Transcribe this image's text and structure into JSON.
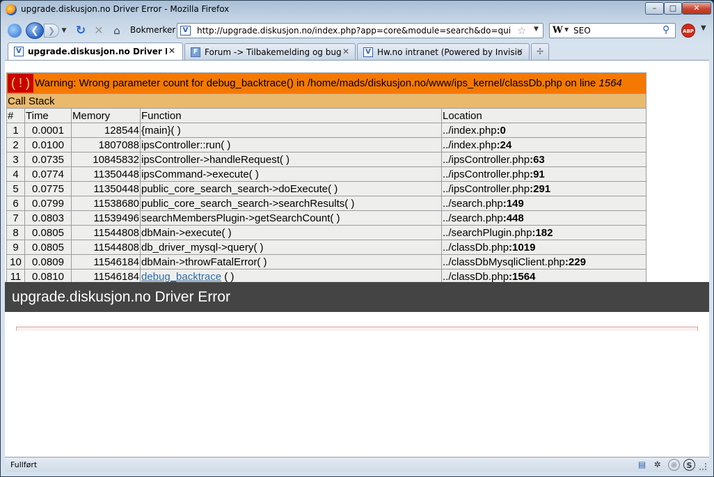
{
  "window": {
    "title": "upgrade.diskusjon.no Driver Error - Mozilla Firefox",
    "minimize_label": "–",
    "maximize_label": "□",
    "close_label": "✕"
  },
  "navbar": {
    "bookmarks_label": "Bokmerker",
    "url": "http://upgrade.diskusjon.no/index.php?app=core&module=search&do=quick_search",
    "search_engine": "W",
    "search_value": "SEO",
    "abp_label": "ABP"
  },
  "tabs": [
    {
      "label": "upgrade.diskusjon.no Driver Error",
      "active": true,
      "icon": "vbulletin-v-icon"
    },
    {
      "label": "Forum -> Tilbakemelding og bugfix...",
      "active": false,
      "icon": "forum-icon"
    },
    {
      "label": "Hw.no intranet (Powered by Invisio...",
      "active": false,
      "icon": "vbulletin-v-icon"
    }
  ],
  "xdebug": {
    "warning_badge": "( ! )",
    "warning_text": "Warning: Wrong parameter count for debug_backtrace() in /home/mads/diskusjon.no/www/ips_kernel/classDb.php on line ",
    "warning_line": "1564",
    "call_stack_label": "Call Stack",
    "headers": [
      "#",
      "Time",
      "Memory",
      "Function",
      "Location"
    ],
    "rows": [
      {
        "num": "1",
        "time": "0.0001",
        "memory": "128544",
        "function": "{main}( )",
        "loc_path": "../index.php",
        "loc_line": ":0"
      },
      {
        "num": "2",
        "time": "0.0100",
        "memory": "1807088",
        "function": "ipsController::run( )",
        "loc_path": "../index.php",
        "loc_line": ":24"
      },
      {
        "num": "3",
        "time": "0.0735",
        "memory": "10845832",
        "function": "ipsController->handleRequest( )",
        "loc_path": "../ipsController.php",
        "loc_line": ":63"
      },
      {
        "num": "4",
        "time": "0.0774",
        "memory": "11350448",
        "function": "ipsCommand->execute( )",
        "loc_path": "../ipsController.php",
        "loc_line": ":91"
      },
      {
        "num": "5",
        "time": "0.0775",
        "memory": "11350448",
        "function": "public_core_search_search->doExecute( )",
        "loc_path": "../ipsController.php",
        "loc_line": ":291"
      },
      {
        "num": "6",
        "time": "0.0799",
        "memory": "11538680",
        "function": "public_core_search_search->searchResults( )",
        "loc_path": "../search.php",
        "loc_line": ":149"
      },
      {
        "num": "7",
        "time": "0.0803",
        "memory": "11539496",
        "function": "searchMembersPlugin->getSearchCount( )",
        "loc_path": "../search.php",
        "loc_line": ":448"
      },
      {
        "num": "8",
        "time": "0.0805",
        "memory": "11544808",
        "function": "dbMain->execute( )",
        "loc_path": "../searchPlugin.php",
        "loc_line": ":182"
      },
      {
        "num": "9",
        "time": "0.0805",
        "memory": "11544808",
        "function": "db_driver_mysql->query( )",
        "loc_path": "../classDb.php",
        "loc_line": ":1019"
      },
      {
        "num": "10",
        "time": "0.0809",
        "memory": "11546184",
        "function": "dbMain->throwFatalError( )",
        "loc_path": "../classDbMysqliClient.php",
        "loc_line": ":229"
      },
      {
        "num": "11",
        "time": "0.0810",
        "memory": "11546184",
        "function_link": "debug_backtrace",
        "function_suffix": " ( )",
        "loc_path": "../classDb.php",
        "loc_line": ":1564"
      }
    ]
  },
  "error_header": "upgrade.diskusjon.no Driver Error",
  "statusbar": {
    "text": "Fullført"
  }
}
